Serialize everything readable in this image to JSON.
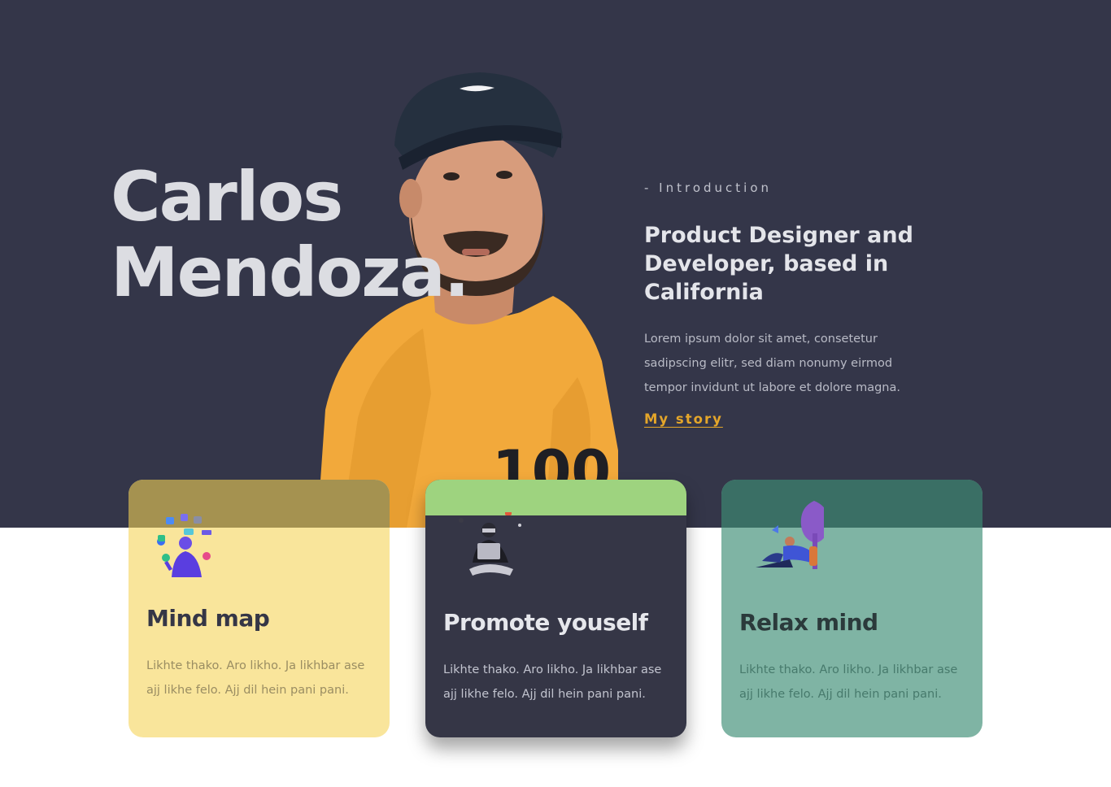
{
  "hero": {
    "name_line1": "Carlos",
    "name_line2": "Mendoza.",
    "intro_label": "- Introduction",
    "headline": "Product Designer and Developer, based in California",
    "description": "Lorem ipsum dolor sit amet, consetetur sadipscing elitr, sed diam nonumy eirmod tempor invidunt ut labore et dolore magna.",
    "story_link": "My story"
  },
  "cards": [
    {
      "title": "Mind map",
      "text": "Likhte thako. Aro likho. Ja likhbar ase ajj likhe felo. Ajj dil hein pani pani.",
      "icon": "juggling-apps-illustration"
    },
    {
      "title": "Promote youself",
      "text": "Likhte thako. Aro likho. Ja likhbar ase ajj likhe felo. Ajj dil hein pani pani.",
      "icon": "laptop-person-illustration"
    },
    {
      "title": "Relax mind",
      "text": "Likhte thako. Aro likho. Ja likhbar ase ajj likhe felo. Ajj dil hein pani pani.",
      "icon": "reading-under-tree-illustration"
    }
  ],
  "colors": {
    "hero_bg": "#343649",
    "accent": "#e4a62a",
    "card1": "#f9e59b",
    "card2": "#353646",
    "card3": "#7fb4a4"
  }
}
